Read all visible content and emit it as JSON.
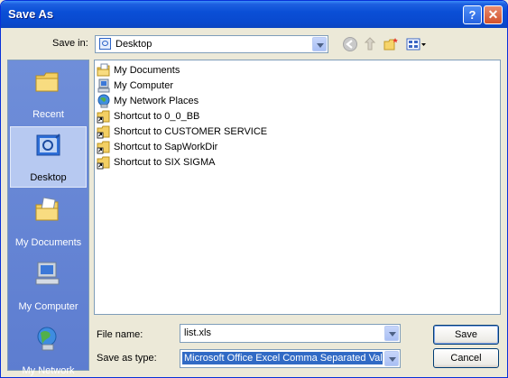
{
  "window": {
    "title": "Save As",
    "help_label": "?",
    "close_label": "✕"
  },
  "toolbar": {
    "save_in_label": "Save in:",
    "save_in_value": "Desktop",
    "icons": [
      "back-icon",
      "up-folder-icon",
      "new-folder-icon",
      "views-menu-icon"
    ]
  },
  "places": [
    {
      "label": "Recent",
      "icon": "recent-folder-icon",
      "active": false
    },
    {
      "label": "Desktop",
      "icon": "desktop-icon",
      "active": true
    },
    {
      "label": "My Documents",
      "icon": "my-documents-icon",
      "active": false
    },
    {
      "label": "My Computer",
      "icon": "my-computer-icon",
      "active": false
    },
    {
      "label": "My Network",
      "icon": "my-network-icon",
      "active": false
    }
  ],
  "files": [
    {
      "name": "My Documents",
      "icon": "my-documents-icon"
    },
    {
      "name": "My Computer",
      "icon": "my-computer-icon"
    },
    {
      "name": "My Network Places",
      "icon": "my-network-icon"
    },
    {
      "name": "Shortcut to 0_0_BB",
      "icon": "folder-shortcut-icon"
    },
    {
      "name": "Shortcut to CUSTOMER SERVICE",
      "icon": "folder-shortcut-icon"
    },
    {
      "name": "Shortcut to SapWorkDir",
      "icon": "folder-shortcut-icon"
    },
    {
      "name": "Shortcut to SIX SIGMA",
      "icon": "folder-shortcut-icon"
    }
  ],
  "form": {
    "file_name_label": "File name:",
    "file_name_value": "list.xls",
    "save_as_type_label": "Save as type:",
    "save_as_type_value": "Microsoft Office Excel Comma Separated Values"
  },
  "buttons": {
    "save": "Save",
    "cancel": "Cancel"
  }
}
